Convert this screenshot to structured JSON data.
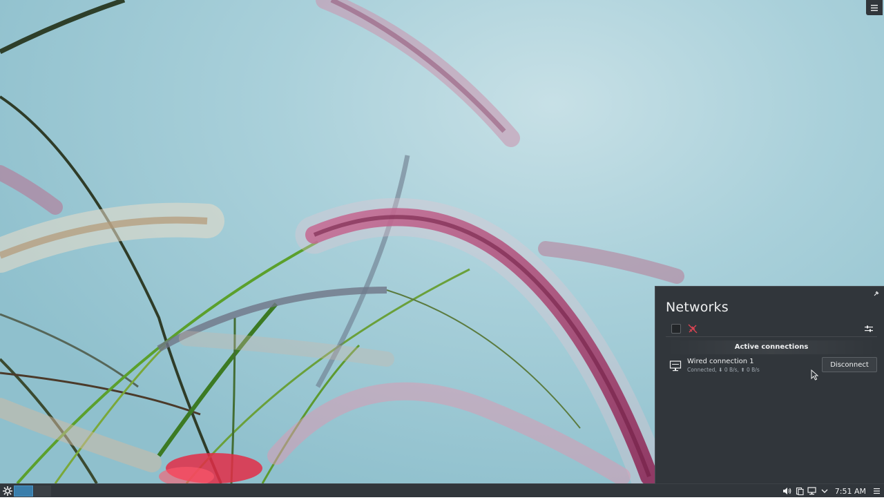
{
  "wallpaper": {
    "description_icon": "grass-plumes-wallpaper"
  },
  "networks": {
    "title": "Networks",
    "icons": {
      "pin": "pin-icon",
      "wifi_toggle": "checkbox",
      "airplane": "airplane-mode-icon",
      "configure": "configure-icon"
    },
    "section_header": "Active connections",
    "connections": [
      {
        "name": "Wired connection 1",
        "status": "Connected, ⬇ 0 B/s, ⬆ 0 B/s",
        "icon": "wired-network-icon",
        "action_label": "Disconnect"
      }
    ]
  },
  "taskbar": {
    "launcher_icon": "kde-launcher-icon",
    "pager": {
      "desktops": 2,
      "active": 0
    },
    "tray_icons": [
      "volume-icon",
      "clipboard-icon",
      "network-wired-icon",
      "expand-tray-icon"
    ],
    "clock": "7:51 AM",
    "menu_icon": "panel-menu-icon"
  },
  "colors": {
    "panel_bg": "#31363b",
    "text": "#eff0f1",
    "accent": "#3a7eab",
    "airplane_red": "#da4453"
  }
}
